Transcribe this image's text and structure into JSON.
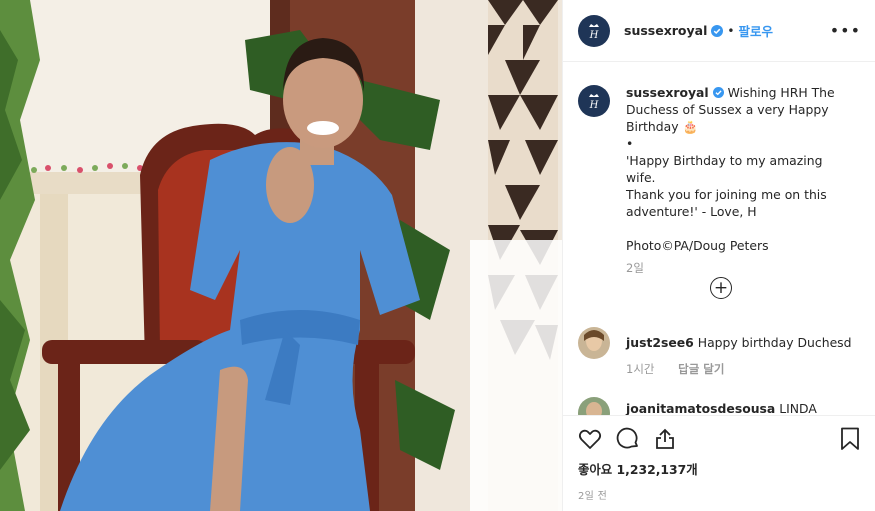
{
  "post": {
    "photo_icon": "photo-of-woman-in-blue-dress-seated-in-carved-wooden-chair"
  },
  "header": {
    "username": "sussexroyal",
    "separator": "•",
    "follow_label": "팔로우",
    "more_label": "•••",
    "avatar_icon": "royal-monogram-icon"
  },
  "caption": {
    "username": "sussexroyal",
    "line1": "Wishing HRH The",
    "line2": "Duchess of Sussex a very Happy",
    "line3": "Birthday 🎂",
    "bullet": "•",
    "line4": "'Happy Birthday to my amazing wife.",
    "line5": "Thank you for joining me on this",
    "line6": "adventure!' - Love, H",
    "credit": "Photo©PA/Doug Peters",
    "time_ago": "2일"
  },
  "comments": [
    {
      "username": "just2see6",
      "text": "Happy birthday Duchesd",
      "time": "1시간",
      "reply_label": "답글 달기"
    },
    {
      "username": "joanitamatosdesousa",
      "text": "LINDA"
    }
  ],
  "actions": {
    "likes_label": "좋아요",
    "likes_count": "1,232,137개",
    "date": "2일 전"
  },
  "colors": {
    "link_blue": "#3897f0",
    "verified_blue": "#3897f0",
    "avatar_navy": "#1f3557",
    "dress_blue": "#4f8fd4"
  }
}
